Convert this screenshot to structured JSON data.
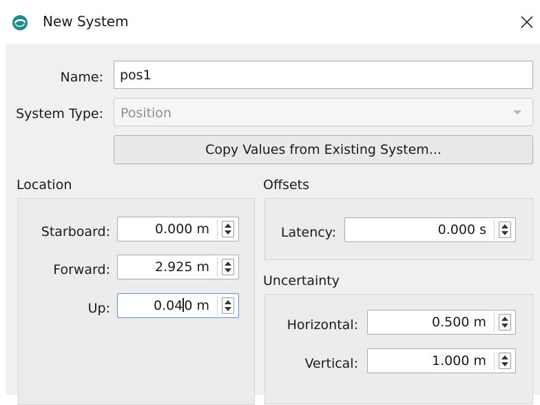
{
  "window": {
    "title": "New System",
    "icon": "app-logo-icon",
    "close_icon": "close-icon"
  },
  "form": {
    "name_label": "Name:",
    "name_value": "pos1",
    "system_type_label": "System Type:",
    "system_type_value": "Position",
    "copy_button_label": "Copy Values from Existing System..."
  },
  "location": {
    "heading": "Location",
    "starboard": {
      "label": "Starboard:",
      "value": "0.000 m"
    },
    "forward": {
      "label": "Forward:",
      "value": "2.925 m"
    },
    "up": {
      "label": "Up:",
      "value_before_caret": "0.04",
      "value_after_caret": "0 m"
    }
  },
  "offsets": {
    "heading": "Offsets",
    "latency": {
      "label": "Latency:",
      "value": "0.000 s"
    }
  },
  "uncertainty": {
    "heading": "Uncertainty",
    "horizontal": {
      "label": "Horizontal:",
      "value": "0.500 m"
    },
    "vertical": {
      "label": "Vertical:",
      "value": "1.000 m"
    }
  },
  "colors": {
    "accent": "#1e8a8a",
    "focus_border": "#5b8ed6",
    "dialog_bg": "#f0f0f0"
  }
}
